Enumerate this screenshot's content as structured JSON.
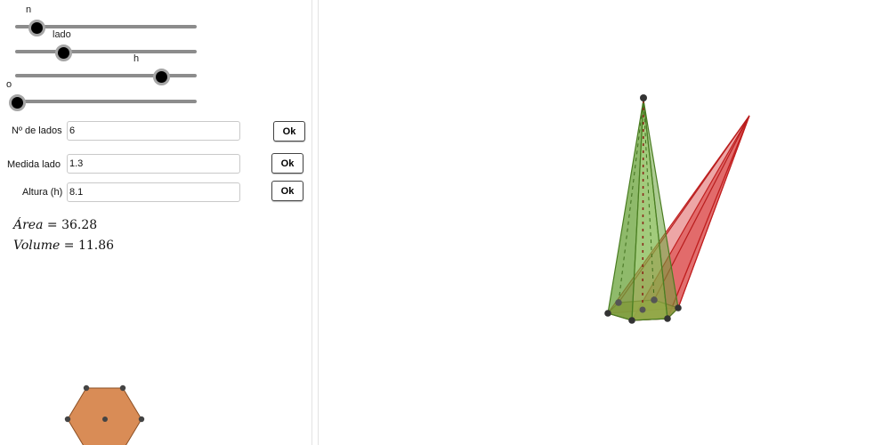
{
  "sliders": [
    {
      "label": "n",
      "value_fraction": 0.12
    },
    {
      "label": "lado",
      "value_fraction": 0.26
    },
    {
      "label": "h",
      "value_fraction": 0.8
    },
    {
      "label": "o",
      "value_fraction": 0.0
    }
  ],
  "fields": [
    {
      "label": "Nº de lados",
      "value": "6",
      "button": "Ok"
    },
    {
      "label": "Medida lado",
      "value": "1.3",
      "button": "Ok"
    },
    {
      "label": "Altura (h)",
      "value": "8.1",
      "button": "Ok"
    }
  ],
  "results": {
    "area_label": "Área",
    "area_value": "36.28",
    "volume_label": "Volume",
    "volume_value": "11.86",
    "equals": "="
  },
  "colors": {
    "hexagon_fill": "#d98c56",
    "pyramid_green": "#6aa33a",
    "pyramid_red": "#d83a3a",
    "slider_knob": "#000000"
  }
}
